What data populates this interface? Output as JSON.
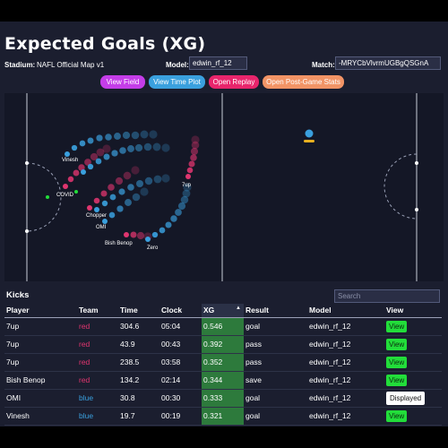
{
  "title": "Expected Goals (XG)",
  "controls": {
    "stadium_label": "Stadium:",
    "stadium_value": "NAFL Official Map v1",
    "model_label": "Model:",
    "model_value": "edwin_rf_12",
    "match_label": "Match:",
    "match_value": "-MRYCbVlvrmUGBgQSGnA"
  },
  "buttons": {
    "view_field": "View Field",
    "view_time_plot": "View Time Plot",
    "open_replay": "Open Replay",
    "open_post_game": "Open Post-Game Stats"
  },
  "colors": {
    "red_team": "#e0356f",
    "blue_team": "#3aa0de",
    "pill_view_field": "#c43de8",
    "pill_time_plot": "#3aa0de",
    "pill_replay": "#e8256c",
    "pill_post_game": "#f29466",
    "view_button": "#22dd3a"
  },
  "field": {
    "player_labels": [
      "Vinesh",
      "COVID",
      "7up",
      "Chopper",
      "OMI",
      "Bish Benop",
      "Zero"
    ],
    "ball_icon": "ball-icon"
  },
  "kicks": {
    "title": "Kicks",
    "search_placeholder": "Search",
    "sort_indicator": "▲",
    "columns": [
      "Player",
      "Team",
      "Time",
      "Clock",
      "XG",
      "Result",
      "Model",
      "View"
    ],
    "rows": [
      {
        "player": "7up",
        "team": "red",
        "time": "304.6",
        "clock": "05:04",
        "xg": "0.546",
        "result": "goal",
        "model": "edwin_rf_12",
        "view": "View"
      },
      {
        "player": "7up",
        "team": "red",
        "time": "43.9",
        "clock": "00:43",
        "xg": "0.392",
        "result": "pass",
        "model": "edwin_rf_12",
        "view": "View"
      },
      {
        "player": "7up",
        "team": "red",
        "time": "238.5",
        "clock": "03:58",
        "xg": "0.352",
        "result": "pass",
        "model": "edwin_rf_12",
        "view": "View"
      },
      {
        "player": "Bish Benop",
        "team": "red",
        "time": "134.2",
        "clock": "02:14",
        "xg": "0.344",
        "result": "save",
        "model": "edwin_rf_12",
        "view": "View"
      },
      {
        "player": "OMI",
        "team": "blue",
        "time": "30.8",
        "clock": "00:30",
        "xg": "0.333",
        "result": "goal",
        "model": "edwin_rf_12",
        "view": "Displayed"
      },
      {
        "player": "Vinesh",
        "team": "blue",
        "time": "19.7",
        "clock": "00:19",
        "xg": "0.321",
        "result": "goal",
        "model": "edwin_rf_12",
        "view": "View"
      }
    ]
  }
}
